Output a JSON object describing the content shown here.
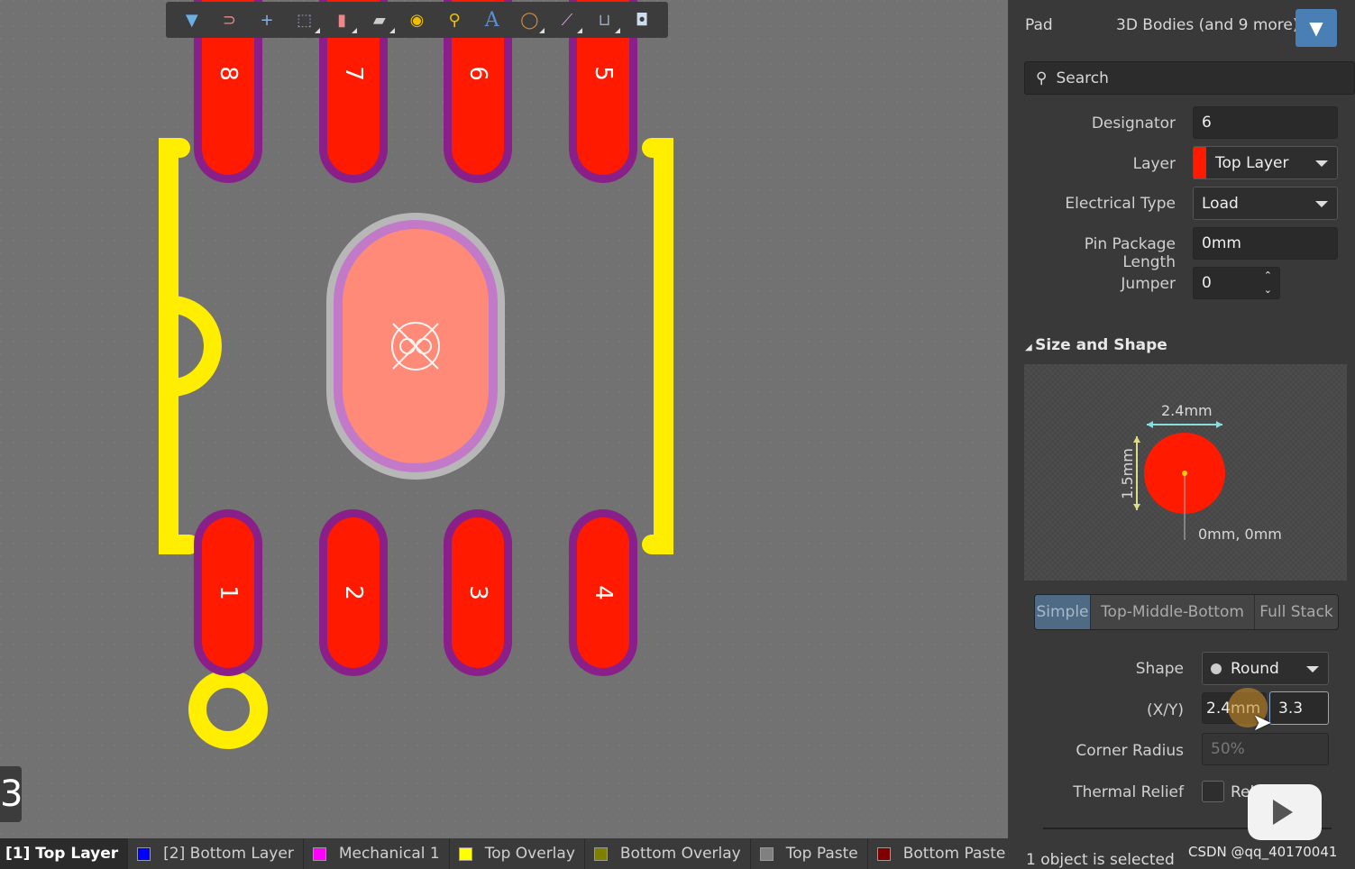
{
  "toolbar": {
    "icons": [
      "filter-icon",
      "interactive-routing-icon",
      "cross-icon",
      "select-rect-icon",
      "align-icon",
      "component-icon",
      "pad-icon",
      "via-icon",
      "text-icon",
      "arc-icon",
      "line-icon",
      "dimension-icon",
      "region-icon"
    ]
  },
  "canvas": {
    "pad_labels_top": [
      "8",
      "7",
      "6",
      "5"
    ],
    "pad_labels_bottom": [
      "1",
      "2",
      "3",
      "4"
    ],
    "left_number": "3",
    "colors": {
      "pad": "#ff1a00",
      "solder_mask": "#8a1f8a",
      "overlay": "#ffee00",
      "center_pad": "#ff8a78"
    }
  },
  "layers": [
    {
      "label": "[1] Top Layer",
      "color": "#ff0000",
      "active": true
    },
    {
      "label": "[2] Bottom Layer",
      "color": "#0000ff"
    },
    {
      "label": "Mechanical 1",
      "color": "#ff00ff"
    },
    {
      "label": "Top Overlay",
      "color": "#ffff00"
    },
    {
      "label": "Bottom Overlay",
      "color": "#808000"
    },
    {
      "label": "Top Paste",
      "color": "#808080"
    },
    {
      "label": "Bottom Paste",
      "color": "#800000"
    },
    {
      "label": "",
      "color": "#800080"
    }
  ],
  "panel": {
    "object_type": "Pad",
    "filter_text": "3D Bodies (and 9 more)",
    "search_placeholder": "Search",
    "designator_label": "Designator",
    "designator": "6",
    "layer_label": "Layer",
    "layer": "Top Layer",
    "layer_color": "#ff0000",
    "etype_label": "Electrical Type",
    "etype": "Load",
    "ppl_label": "Pin Package Length",
    "ppl": "0mm",
    "jumper_label": "Jumper",
    "jumper": "0",
    "section": "Size and Shape",
    "preview": {
      "width": "2.4mm",
      "height": "1.5mm",
      "origin": "0mm, 0mm"
    },
    "tabs": [
      "Simple",
      "Top-Middle-Bottom",
      "Full Stack"
    ],
    "shape_label": "Shape",
    "shape": "Round",
    "xy_label": "(X/Y)",
    "x": "2.4mm",
    "y": "3.3",
    "corner_label": "Corner Radius",
    "corner": "50%",
    "thermal_label": "Thermal Relief",
    "thermal": "Relief, 0"
  },
  "status": "1 object is selected",
  "watermark": "CSDN @qq_40170041"
}
